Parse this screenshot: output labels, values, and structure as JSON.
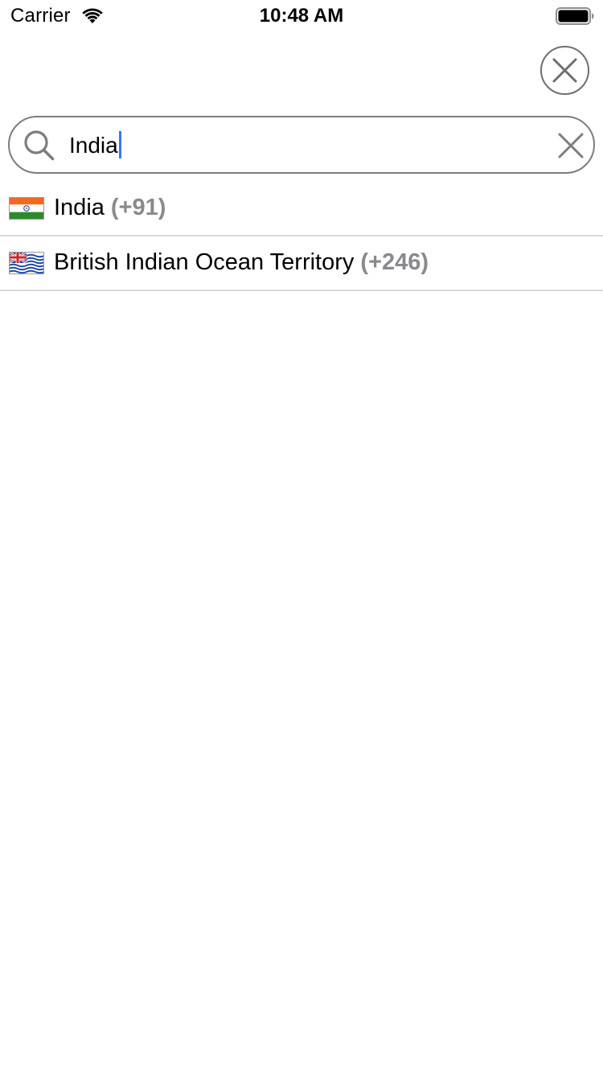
{
  "status_bar": {
    "carrier": "Carrier",
    "time": "10:48 AM"
  },
  "header": {
    "close_icon": "close-circle-icon"
  },
  "search": {
    "value": "India",
    "placeholder": "",
    "search_icon": "magnifier-icon",
    "clear_icon": "x-icon"
  },
  "results": [
    {
      "name": "India",
      "dial_code": "(+91)",
      "flag": "india-flag-icon"
    },
    {
      "name": "British Indian Ocean Territory",
      "dial_code": "(+246)",
      "flag": "biot-flag-icon"
    }
  ],
  "colors": {
    "caret": "#3478f6",
    "dial_code": "#8a8a8e",
    "separator": "#d8d8dc",
    "outline": "#7d7d7d"
  }
}
